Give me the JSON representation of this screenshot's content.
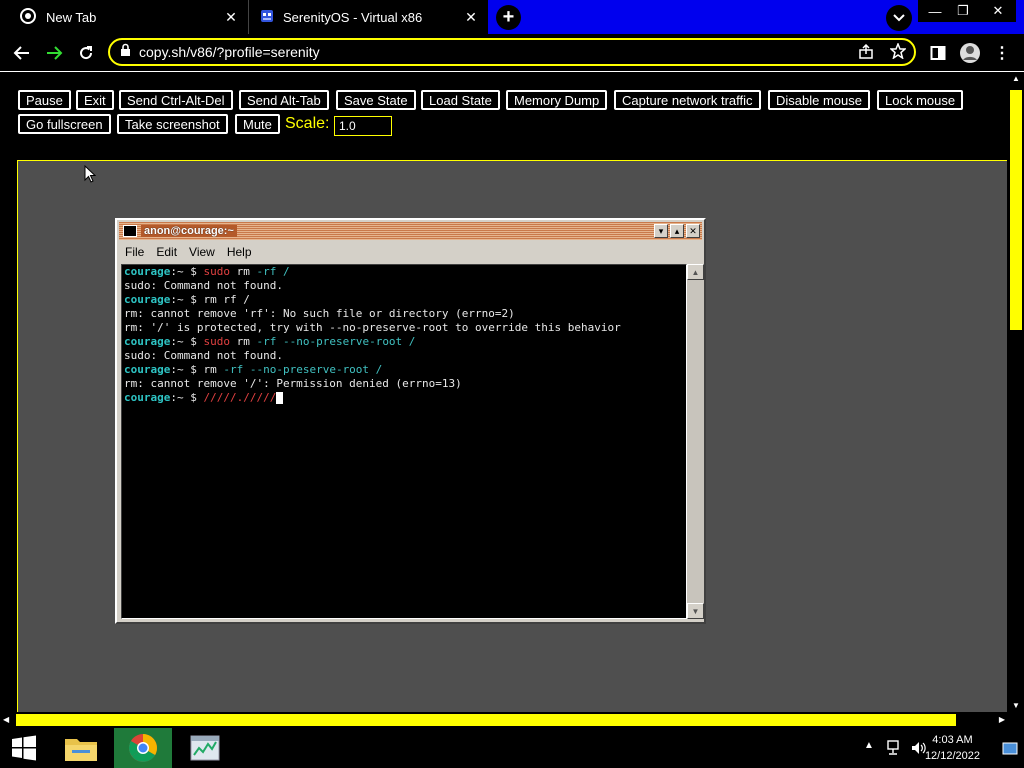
{
  "browser": {
    "tabs": [
      {
        "title": "New Tab",
        "icon": "chrome-icon"
      },
      {
        "title": "SerenityOS - Virtual x86",
        "icon": "serenity-icon"
      }
    ],
    "url": "copy.sh/v86/?profile=serenity"
  },
  "controls": {
    "row1": [
      "Pause",
      "Exit",
      "Send Ctrl-Alt-Del",
      "Send Alt-Tab",
      "Save State",
      "Load State",
      "Memory Dump",
      "Capture network traffic",
      "Disable mouse",
      "Lock mouse"
    ],
    "row2": [
      "Go fullscreen",
      "Take screenshot",
      "Mute"
    ],
    "scale_label": "Scale:",
    "scale_value": "1.0"
  },
  "terminal": {
    "title": "anon@courage:~",
    "menu": [
      "File",
      "Edit",
      "View",
      "Help"
    ],
    "prompt_user": "courage",
    "prompt_rest": ":~ $ ",
    "lines": [
      {
        "prompt": true,
        "parts": [
          {
            "t": "sudo",
            "c": "red"
          },
          {
            "t": " rm ",
            "c": "white"
          },
          {
            "t": "-rf /",
            "c": "teal"
          }
        ]
      },
      {
        "prompt": false,
        "parts": [
          {
            "t": "sudo: Command not found.",
            "c": "white"
          }
        ]
      },
      {
        "prompt": true,
        "parts": [
          {
            "t": "rm",
            "c": "white"
          },
          {
            "t": " rf /",
            "c": "white"
          }
        ]
      },
      {
        "prompt": false,
        "parts": [
          {
            "t": "rm: cannot remove 'rf': No such file or directory (errno=2)",
            "c": "white"
          }
        ]
      },
      {
        "prompt": false,
        "parts": [
          {
            "t": "rm: '/' is protected, try with --no-preserve-root to override this behavior",
            "c": "white"
          }
        ]
      },
      {
        "prompt": true,
        "parts": [
          {
            "t": "sudo",
            "c": "red"
          },
          {
            "t": " rm ",
            "c": "white"
          },
          {
            "t": "-rf --no-preserve-root /",
            "c": "teal"
          }
        ]
      },
      {
        "prompt": false,
        "parts": [
          {
            "t": "sudo: Command not found.",
            "c": "white"
          }
        ]
      },
      {
        "prompt": true,
        "parts": [
          {
            "t": "rm",
            "c": "white"
          },
          {
            "t": " -rf --no-preserve-root /",
            "c": "teal"
          }
        ]
      },
      {
        "prompt": false,
        "parts": [
          {
            "t": "rm: cannot remove '/': Permission denied (errno=13)",
            "c": "white"
          }
        ]
      },
      {
        "prompt": true,
        "cursor": true,
        "parts": [
          {
            "t": "/////./////",
            "c": "red"
          }
        ]
      }
    ]
  },
  "taskbar": {
    "apps": [
      "start-icon",
      "file-explorer-icon",
      "chrome-icon",
      "task-manager-icon"
    ],
    "time": "4:03 AM",
    "date": "12/12/2022"
  },
  "colors": {
    "accent": "#ffff00",
    "tabstrip": "#0000ee",
    "vm_background": "#4f4f4f"
  }
}
